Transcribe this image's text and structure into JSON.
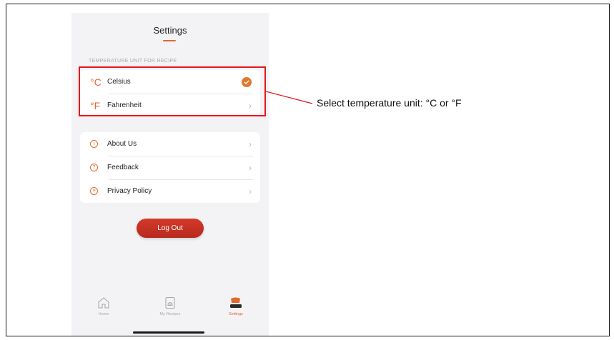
{
  "header": {
    "title": "Settings"
  },
  "temperature": {
    "caption": "TEMPERATURE UNIT FOR RECIPE",
    "options": [
      {
        "symbol": "°C",
        "label": "Celsius",
        "selected": true
      },
      {
        "symbol": "°F",
        "label": "Fahrenheit",
        "selected": false
      }
    ]
  },
  "info_menu": {
    "items": [
      {
        "label": "About Us",
        "icon": "info-icon",
        "icon_glyph": "i"
      },
      {
        "label": "Feedback",
        "icon": "question-icon",
        "icon_glyph": "?"
      },
      {
        "label": "Privacy Policy",
        "icon": "document-icon",
        "icon_glyph": "≡"
      }
    ]
  },
  "logout_label": "Log Out",
  "tabs": [
    {
      "label": "Home",
      "icon": "home-icon",
      "active": false
    },
    {
      "label": "My Recipes",
      "icon": "recipe-book-icon",
      "active": false
    },
    {
      "label": "Settings",
      "icon": "settings-pot-icon",
      "active": true
    }
  ],
  "annotation": {
    "text": "Select temperature unit: °C or °F"
  },
  "colors": {
    "accent": "#e2682f",
    "logout": "#c9301f",
    "highlight": "#e4161b"
  }
}
